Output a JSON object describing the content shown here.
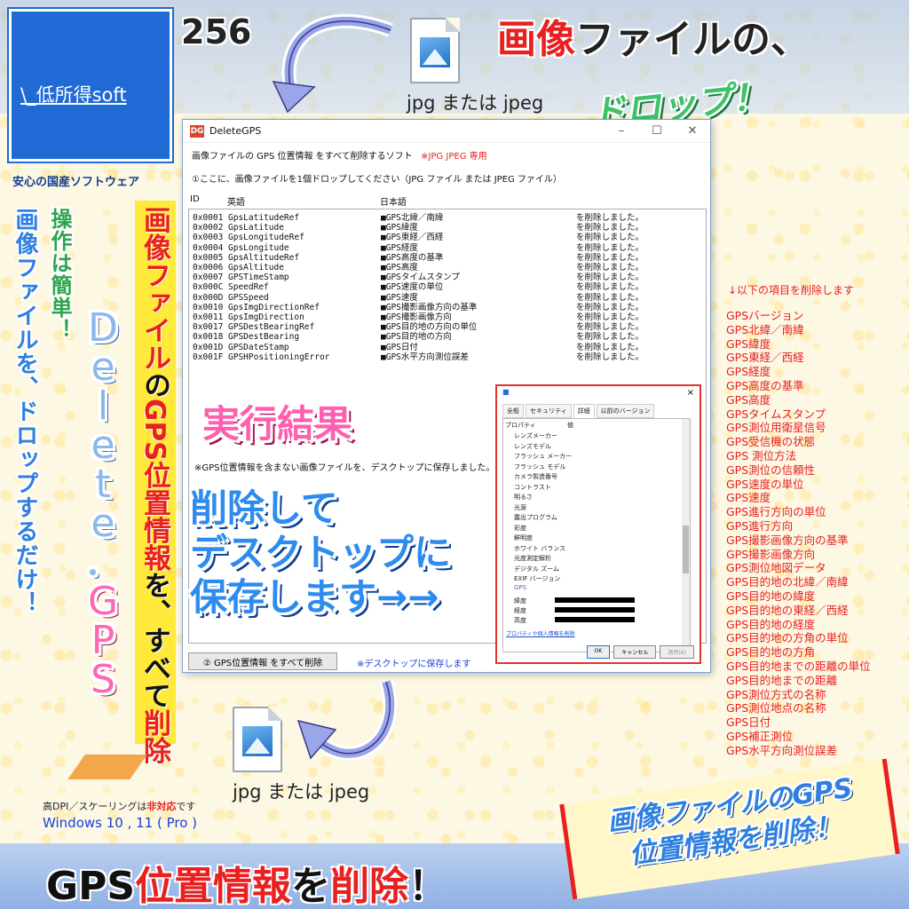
{
  "logo": {
    "text": "\\_低所得soft",
    "subtitle": "安心の国産ソフトウェア"
  },
  "number": "256",
  "headline": {
    "part1": "画像",
    "part2": "ファイルの、"
  },
  "drop_text": "ドロップ！",
  "file_top_label": "jpg または jpeg",
  "file_bottom_label": "jpg または jpeg",
  "window": {
    "title": "DeleteGPS",
    "app_icon": "DG",
    "info_line": "画像ファイルの GPS 位置情報 をすべて削除するソフト",
    "info_note": "※JPG JPEG 専用",
    "instruction": "①ここに、画像ファイルを1個ドロップしてください（JPG ファイル または JPEG ファイル）",
    "columns": {
      "id": "ID",
      "en": "英語",
      "ja": "日本語"
    },
    "rows": [
      {
        "id": "0x0001",
        "en": "GpsLatitudeRef",
        "ja": "■GPS北緯／南緯",
        "result": "を削除しました。"
      },
      {
        "id": "0x0002",
        "en": "GpsLatitude",
        "ja": "■GPS緯度",
        "result": "を削除しました。"
      },
      {
        "id": "0x0003",
        "en": "GpsLongitudeRef",
        "ja": "■GPS東経／西経",
        "result": "を削除しました。"
      },
      {
        "id": "0x0004",
        "en": "GpsLongitude",
        "ja": "■GPS経度",
        "result": "を削除しました。"
      },
      {
        "id": "0x0005",
        "en": "GpsAltitudeRef",
        "ja": "■GPS高度の基準",
        "result": "を削除しました。"
      },
      {
        "id": "0x0006",
        "en": "GpsAltitude",
        "ja": "■GPS高度",
        "result": "を削除しました。"
      },
      {
        "id": "0x0007",
        "en": "GPSTimeStamp",
        "ja": "■GPSタイムスタンプ",
        "result": "を削除しました。"
      },
      {
        "id": "0x000C",
        "en": "SpeedRef",
        "ja": "■GPS速度の単位",
        "result": "を削除しました。"
      },
      {
        "id": "0x000D",
        "en": "GPSSpeed",
        "ja": "■GPS速度",
        "result": "を削除しました。"
      },
      {
        "id": "0x0010",
        "en": "GpsImgDirectionRef",
        "ja": "■GPS撮影画像方向の基準",
        "result": "を削除しました。"
      },
      {
        "id": "0x0011",
        "en": "GpsImgDirection",
        "ja": "■GPS撮影画像方向",
        "result": "を削除しました。"
      },
      {
        "id": "0x0017",
        "en": "GPSDestBearingRef",
        "ja": "■GPS目的地の方向の単位",
        "result": "を削除しました。"
      },
      {
        "id": "0x0018",
        "en": "GPSDestBearing",
        "ja": "■GPS目的地の方向",
        "result": "を削除しました。"
      },
      {
        "id": "0x001D",
        "en": "GPSDateStamp",
        "ja": "■GPS日付",
        "result": "を削除しました。"
      },
      {
        "id": "0x001F",
        "en": "GPSHPositioningError",
        "ja": "■GPS水平方向測位誤差",
        "result": "を削除しました。"
      }
    ],
    "saved_note": "※GPS位置情報を含まない画像ファイルを、デスクトップに保存しました。",
    "delete_button": "② GPS位置情報 をすべて削除",
    "desktop_note": "※デスクトップに保存します"
  },
  "overlay": {
    "result_label": "実行結果",
    "save_lines": [
      "削除して",
      "デスクトップに",
      "保存します→→"
    ]
  },
  "properties": {
    "close": "×",
    "tabs": [
      "全般",
      "セキュリティ",
      "詳細",
      "以前のバージョン"
    ],
    "active_tab": 2,
    "header": {
      "prop": "プロパティ",
      "value": "値"
    },
    "items": [
      "レンズメーカー",
      "レンズモデル",
      "フラッシュ メーカー",
      "フラッシュ モデル",
      "カメラ製造番号",
      "コントラスト",
      "明るさ",
      "光源",
      "露出プログラム",
      "彩度",
      "鮮明度",
      "ホワイト バランス",
      "光度測定解析",
      "デジタル ズーム",
      "EXIF バージョン"
    ],
    "group": "GPS",
    "gps_items": [
      "緯度",
      "経度",
      "高度"
    ],
    "link": "プロパティや個人情報を削除",
    "buttons": {
      "ok": "OK",
      "cancel": "キャンセル",
      "apply": "適用(A)"
    }
  },
  "left_text": {
    "blue_vertical": "画像ファイルを、ドロップするだけ！",
    "green_vertical": "操作は簡単！",
    "delete_gps": [
      "D",
      "e",
      "l",
      "e",
      "t",
      "e",
      "．",
      "G",
      "P",
      "S"
    ],
    "yellow_vertical": {
      "a": "画像ファイル",
      "b": "の",
      "c": "GPS位置情報",
      "d": "を、すべて",
      "e": "削除"
    }
  },
  "notes": {
    "dpi_prefix": "高DPI／スケーリングは",
    "dpi_red": "非対応",
    "dpi_suffix": "です",
    "windows": "Windows 10 , 11 ( Pro )"
  },
  "bottom_title": {
    "a": "GPS",
    "b": "位置情報",
    "c": "を",
    "d": "削除",
    "e": "！"
  },
  "banner": {
    "line1": "画像ファイルのGPS",
    "line2": "位置情報を削除！"
  },
  "right_list": {
    "header": "↓以下の項目を削除します",
    "items": [
      "GPSバージョン",
      "GPS北緯／南緯",
      "GPS緯度",
      "GPS東経／西経",
      "GPS経度",
      "GPS高度の基準",
      "GPS高度",
      "GPSタイムスタンプ",
      "GPS測位用衛星信号",
      "GPS受信機の状態",
      "GPS 測位方法",
      "GPS測位の信頼性",
      "GPS速度の単位",
      "GPS速度",
      "GPS進行方向の単位",
      "GPS進行方向",
      "GPS撮影画像方向の基準",
      "GPS撮影画像方向",
      "GPS測位地図データ",
      "GPS目的地の北緯／南緯",
      "GPS目的地の緯度",
      "GPS目的地の東経／西経",
      "GPS目的地の経度",
      "GPS目的地の方角の単位",
      "GPS目的地の方角",
      "GPS目的地までの距離の単位",
      "GPS目的地までの距離",
      "GPS測位方式の名称",
      "GPS測位地点の名称",
      "GPS日付",
      "GPS補正測位",
      "GPS水平方向測位誤差"
    ]
  },
  "colors": {
    "accent_red": "#e8201f",
    "logo_blue": "#1f6ad4",
    "highlight_yellow": "#ffe93a",
    "green": "#3ec36a",
    "pink": "#ff5fae"
  }
}
